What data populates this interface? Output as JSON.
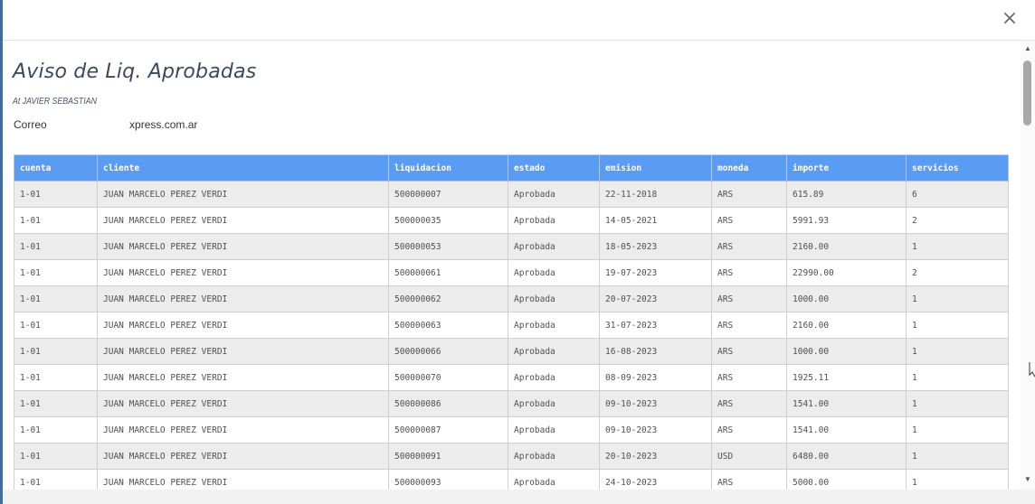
{
  "modal": {
    "close_label": "×",
    "title": "Aviso de Liq. Aprobadas",
    "attention": "At JAVIER SEBASTIAN",
    "email_prefix": "Correo",
    "email_suffix": "xpress.com.ar"
  },
  "table": {
    "columns": [
      "cuenta",
      "cliente",
      "liquidacion",
      "estado",
      "emision",
      "moneda",
      "importe",
      "servicios"
    ],
    "rows": [
      [
        "1-01",
        "JUAN MARCELO PEREZ VERDI",
        "500000007",
        "Aprobada",
        "22-11-2018",
        "ARS",
        "615.89",
        "6"
      ],
      [
        "1-01",
        "JUAN MARCELO PEREZ VERDI",
        "500000035",
        "Aprobada",
        "14-05-2021",
        "ARS",
        "5991.93",
        "2"
      ],
      [
        "1-01",
        "JUAN MARCELO PEREZ VERDI",
        "500000053",
        "Aprobada",
        "18-05-2023",
        "ARS",
        "2160.00",
        "1"
      ],
      [
        "1-01",
        "JUAN MARCELO PEREZ VERDI",
        "500000061",
        "Aprobada",
        "19-07-2023",
        "ARS",
        "22990.00",
        "2"
      ],
      [
        "1-01",
        "JUAN MARCELO PEREZ VERDI",
        "500000062",
        "Aprobada",
        "20-07-2023",
        "ARS",
        "1000.00",
        "1"
      ],
      [
        "1-01",
        "JUAN MARCELO PEREZ VERDI",
        "500000063",
        "Aprobada",
        "31-07-2023",
        "ARS",
        "2160.00",
        "1"
      ],
      [
        "1-01",
        "JUAN MARCELO PEREZ VERDI",
        "500000066",
        "Aprobada",
        "16-08-2023",
        "ARS",
        "1000.00",
        "1"
      ],
      [
        "1-01",
        "JUAN MARCELO PEREZ VERDI",
        "500000070",
        "Aprobada",
        "08-09-2023",
        "ARS",
        "1925.11",
        "1"
      ],
      [
        "1-01",
        "JUAN MARCELO PEREZ VERDI",
        "500000086",
        "Aprobada",
        "09-10-2023",
        "ARS",
        "1541.00",
        "1"
      ],
      [
        "1-01",
        "JUAN MARCELO PEREZ VERDI",
        "500000087",
        "Aprobada",
        "09-10-2023",
        "ARS",
        "1541.00",
        "1"
      ],
      [
        "1-01",
        "JUAN MARCELO PEREZ VERDI",
        "500000091",
        "Aprobada",
        "20-10-2023",
        "USD",
        "6480.00",
        "1"
      ],
      [
        "1-01",
        "JUAN MARCELO PEREZ VERDI",
        "500000093",
        "Aprobada",
        "24-10-2023",
        "ARS",
        "5000.00",
        "1"
      ]
    ]
  },
  "colors": {
    "header_bg": "#5a9bf4",
    "row_alt": "#ececec",
    "title": "#3b4a5c"
  },
  "icons": {
    "close": "close-icon",
    "scroll_up": "chevron-up-icon",
    "scroll_down": "chevron-down-icon"
  }
}
